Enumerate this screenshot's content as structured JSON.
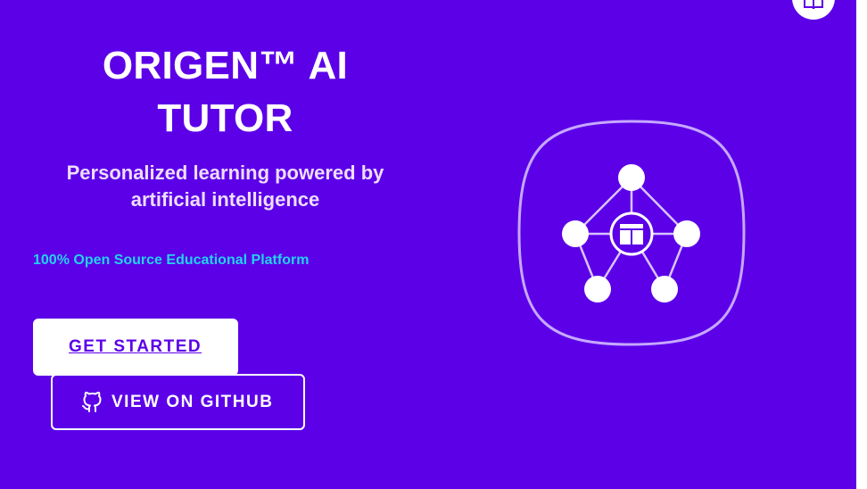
{
  "hero": {
    "title": "ORIGEN™ AI TUTOR",
    "subtitle": "Personalized learning powered by artificial intelligence",
    "tagline": "100% Open Source Educational Platform"
  },
  "actions": {
    "primary_label": "GET STARTED",
    "secondary_label": "VIEW ON GITHUB"
  },
  "icons": {
    "secondary_button": "github-icon",
    "corner_badge": "book-icon",
    "illustration_center": "book-icon"
  },
  "colors": {
    "background": "#5c00e8",
    "accent_text": "#22d3ee",
    "subtitle_text": "#eeddff",
    "button_primary_bg": "#ffffff",
    "button_primary_text": "#5c00e8"
  }
}
